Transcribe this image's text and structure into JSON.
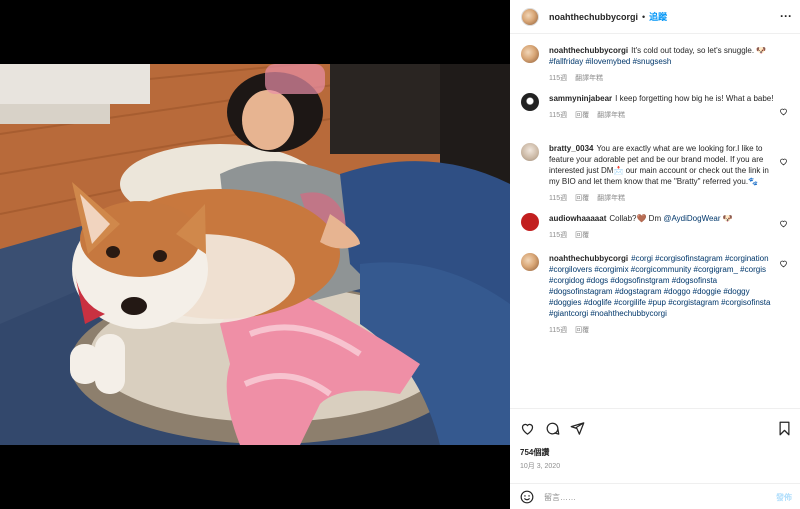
{
  "header": {
    "username": "noahthechubbycorgi",
    "separator": "•",
    "follow_label": "追蹤",
    "more_label": "···"
  },
  "comments": [
    {
      "user": "noahthechubbycorgi",
      "text": "It's cold out today, so let's snuggle. 🐶",
      "tags": "#fallfriday #ilovemybed #snugsesh",
      "time": "115週",
      "translate": "翻譯年糕",
      "reply": ""
    },
    {
      "user": "sammyninjabear",
      "text": "I keep forgetting how big he is! What a babe!",
      "tags": "",
      "time": "115週",
      "reply": "回覆",
      "translate": "翻譯年糕"
    },
    {
      "user": "bratty_0034",
      "text": "You are exactly what are we looking for.I like to feature your adorable pet and be our brand model. If you are interested just DM📩 our main account or check out the link in my BIO and let them know that me \"Bratty\" referred you.🐾",
      "tags": "",
      "time": "115週",
      "reply": "回覆",
      "translate": "翻譯年糕"
    },
    {
      "user": "audiowhaaaaat",
      "text": "Collab?🤎 Dm",
      "tags": "@AydiDogWear 🐶",
      "time": "115週",
      "reply": "回覆",
      "translate": ""
    },
    {
      "user": "noahthechubbycorgi",
      "text": "",
      "tags": "#corgi #corgisofinstagram #corgination #corgilovers #corgimix #corgicommunity #corgigram_ #corgis #corgidog #dogs #dogsofinstgram #dogsofinsta #dogsofinstagram #dogstagram #doggo #doggie #doggy #doggies #doglife #corgilife #pup #corgistagram #corgisofinsta #giantcorgi #noahthechubbycorgi",
      "time": "115週",
      "reply": "回覆",
      "translate": ""
    }
  ],
  "actions": {
    "likes": "754個讚",
    "date": "10月 3, 2020"
  },
  "add_comment": {
    "placeholder": "留言……",
    "post_label": "發佈"
  },
  "colors": {
    "link": "#00376b",
    "follow": "#0095f6",
    "muted": "#8e8e8e"
  },
  "icons": [
    "heart-icon",
    "comment-icon",
    "share-icon",
    "bookmark-icon",
    "emoji-icon",
    "more-icon"
  ]
}
